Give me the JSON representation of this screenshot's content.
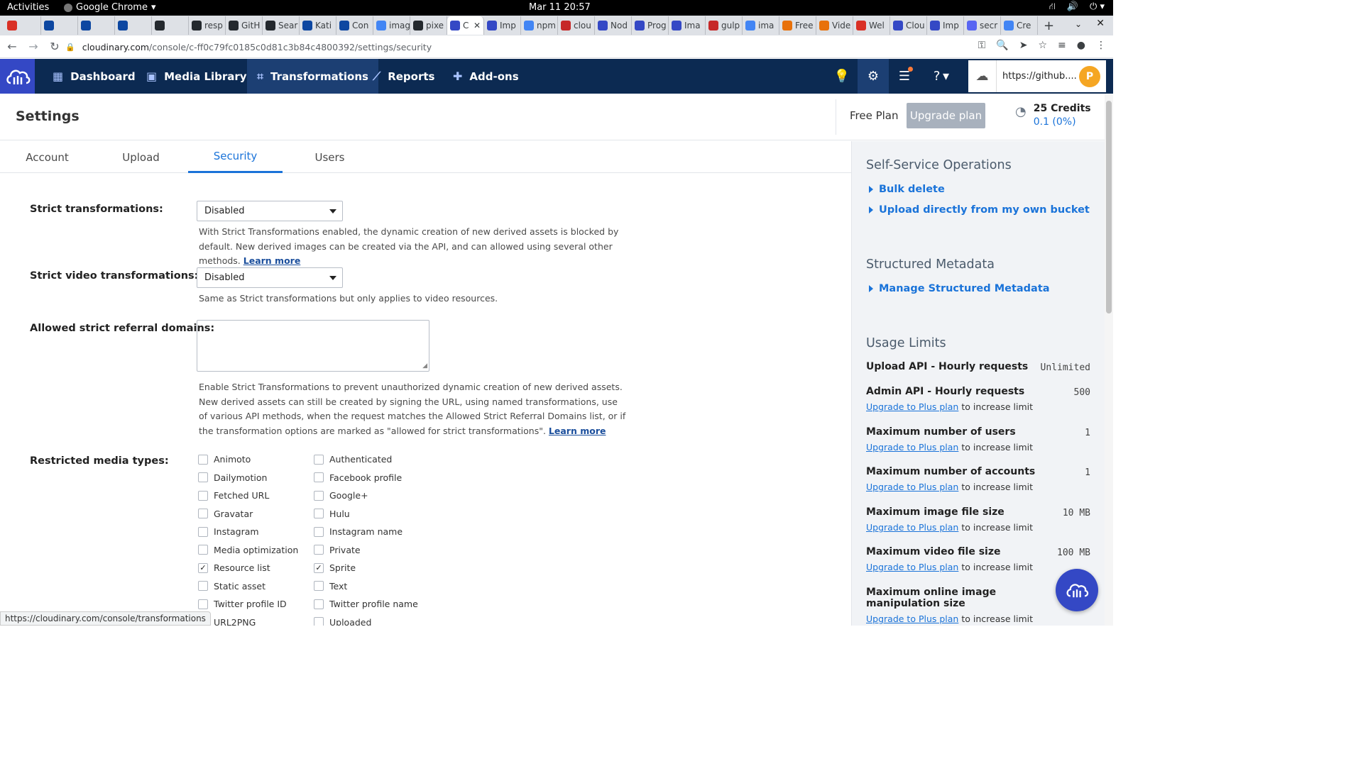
{
  "os": {
    "activities": "Activities",
    "app_name": "Google Chrome",
    "clock": "Mar 11  20:57"
  },
  "browser": {
    "tabs": [
      {
        "label": "",
        "color": "#d93025"
      },
      {
        "label": "",
        "color": "#0d47a1"
      },
      {
        "label": "",
        "color": "#0d47a1"
      },
      {
        "label": "",
        "color": "#0d47a1"
      },
      {
        "label": "",
        "color": "#24292e"
      },
      {
        "label": "resp",
        "color": "#24292e"
      },
      {
        "label": "GitH",
        "color": "#24292e"
      },
      {
        "label": "Sear",
        "color": "#24292e"
      },
      {
        "label": "Kati",
        "color": "#0d47a1"
      },
      {
        "label": "Con",
        "color": "#0d47a1"
      },
      {
        "label": "imag",
        "color": "#4285f4"
      },
      {
        "label": "pixe",
        "color": "#24292e"
      },
      {
        "label": "C",
        "color": "#3448c5"
      },
      {
        "label": "Imp",
        "color": "#3448c5"
      },
      {
        "label": "npm",
        "color": "#4285f4"
      },
      {
        "label": "clou",
        "color": "#c62828"
      },
      {
        "label": "Nod",
        "color": "#3448c5"
      },
      {
        "label": "Prog",
        "color": "#3448c5"
      },
      {
        "label": "Ima",
        "color": "#3448c5"
      },
      {
        "label": "gulp",
        "color": "#c62828"
      },
      {
        "label": "ima",
        "color": "#4285f4"
      },
      {
        "label": "Free",
        "color": "#e8710a"
      },
      {
        "label": "Vide",
        "color": "#e8710a"
      },
      {
        "label": "Wel",
        "color": "#d93025"
      },
      {
        "label": "Clou",
        "color": "#3448c5"
      },
      {
        "label": "Imp",
        "color": "#3448c5"
      },
      {
        "label": "secr",
        "color": "#5865f2"
      },
      {
        "label": "Cre",
        "color": "#4285f4"
      }
    ],
    "url_host": "cloudinary.com",
    "url_path": "/console/c-ff0c79fc0185c0d81c3b84c4800392/settings/security",
    "status_url": "https://cloudinary.com/console/transformations"
  },
  "header": {
    "nav": [
      {
        "label": "Dashboard"
      },
      {
        "label": "Media Library"
      },
      {
        "label": "Transformations"
      },
      {
        "label": "Reports"
      },
      {
        "label": "Add-ons"
      }
    ],
    "cloud_name": "https://github....",
    "avatar_initial": "P"
  },
  "titlebar": {
    "title": "Settings",
    "plan": "Free Plan",
    "upgrade_label": "Upgrade plan",
    "credits": "25 Credits",
    "credits_usage": "0.1 (0%)"
  },
  "tabs": [
    "Account",
    "Upload",
    "Security",
    "Users"
  ],
  "form": {
    "strict_label": "Strict transformations:",
    "strict_value": "Disabled",
    "strict_help": "With Strict Transformations enabled, the dynamic creation of new derived assets is blocked by default. New derived images can be created via the API, and can allowed using several other methods.",
    "learn_more": "Learn more",
    "video_label": "Strict video transformations:",
    "video_value": "Disabled",
    "video_help": "Same as Strict transformations but only applies to video resources.",
    "referral_label": "Allowed strict referral domains:",
    "referral_help": "Enable Strict Transformations to prevent unauthorized dynamic creation of new derived assets. New derived assets can still be created by signing the URL, using named transformations, use of various API methods, when the request matches the Allowed Strict Referral Domains list, or if the transformation options are marked as \"allowed for strict transformations\".",
    "restricted_label": "Restricted media types:",
    "media_col1": [
      {
        "label": "Animoto",
        "checked": false
      },
      {
        "label": "Dailymotion",
        "checked": false
      },
      {
        "label": "Fetched URL",
        "checked": false
      },
      {
        "label": "Gravatar",
        "checked": false
      },
      {
        "label": "Instagram",
        "checked": false
      },
      {
        "label": "Media optimization",
        "checked": false
      },
      {
        "label": "Resource list",
        "checked": true
      },
      {
        "label": "Static asset",
        "checked": false
      },
      {
        "label": "Twitter profile ID",
        "checked": false
      },
      {
        "label": "URL2PNG",
        "checked": false
      }
    ],
    "media_col2": [
      {
        "label": "Authenticated",
        "checked": false
      },
      {
        "label": "Facebook profile",
        "checked": false
      },
      {
        "label": "Google+",
        "checked": false
      },
      {
        "label": "Hulu",
        "checked": false
      },
      {
        "label": "Instagram name",
        "checked": false
      },
      {
        "label": "Private",
        "checked": false
      },
      {
        "label": "Sprite",
        "checked": true
      },
      {
        "label": "Text",
        "checked": false
      },
      {
        "label": "Twitter profile name",
        "checked": false
      },
      {
        "label": "Uploaded",
        "checked": false
      }
    ]
  },
  "sidebar": {
    "ops_title": "Self-Service Operations",
    "ops_links": [
      "Bulk delete",
      "Upload directly from my own bucket"
    ],
    "meta_title": "Structured Metadata",
    "meta_link": "Manage Structured Metadata",
    "usage_title": "Usage Limits",
    "upgrade_link": "Upgrade to Plus plan",
    "upgrade_suffix": "to increase limit",
    "limits": [
      {
        "name": "Upload API - Hourly requests",
        "value": "Unlimited"
      },
      {
        "name": "Admin API - Hourly requests",
        "value": "500"
      },
      {
        "name": "Maximum number of users",
        "value": "1"
      },
      {
        "name": "Maximum number of accounts",
        "value": "1"
      },
      {
        "name": "Maximum image file size",
        "value": "10 MB"
      },
      {
        "name": "Maximum video file size",
        "value": "100 MB"
      },
      {
        "name": "Maximum online image manipulation size",
        "value": ""
      }
    ]
  }
}
